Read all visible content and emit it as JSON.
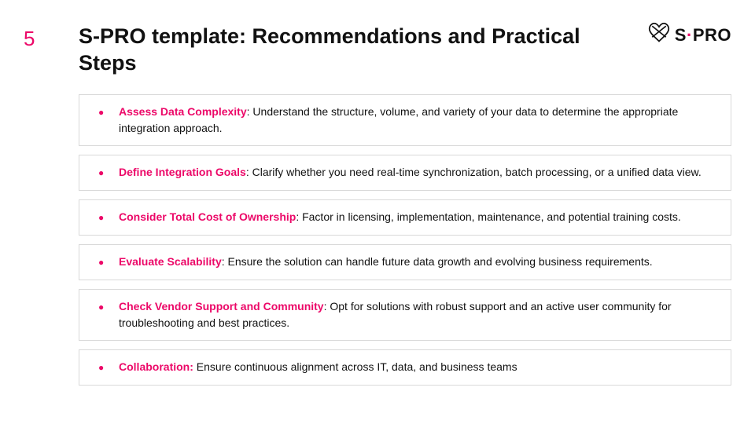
{
  "slide": {
    "number": "5",
    "title": "S-PRO template: Recommendations and Practical Steps"
  },
  "logo": {
    "text_left": "S",
    "dot": "·",
    "text_right": "PRO"
  },
  "items": [
    {
      "head": "Assess Data Complexity",
      "sep": ": ",
      "desc": "Understand the structure, volume, and variety of your data to determine the appropriate integration approach."
    },
    {
      "head": "Define Integration Goals",
      "sep": ": ",
      "desc": "Clarify whether you need real-time synchronization, batch processing, or a unified data view."
    },
    {
      "head": "Consider Total Cost of Ownership",
      "sep": ": ",
      "desc": "Factor in licensing, implementation, maintenance, and potential training costs."
    },
    {
      "head": "Evaluate Scalability",
      "sep": ": ",
      "desc": "Ensure the solution can handle future data growth and evolving business requirements."
    },
    {
      "head": "Check Vendor Support and Community",
      "sep": ": ",
      "desc": "Opt for solutions with robust support and an active user community for troubleshooting and best practices."
    },
    {
      "head": "Collaboration:",
      "sep": " ",
      "desc": "Ensure continuous alignment across IT, data, and business teams"
    }
  ]
}
